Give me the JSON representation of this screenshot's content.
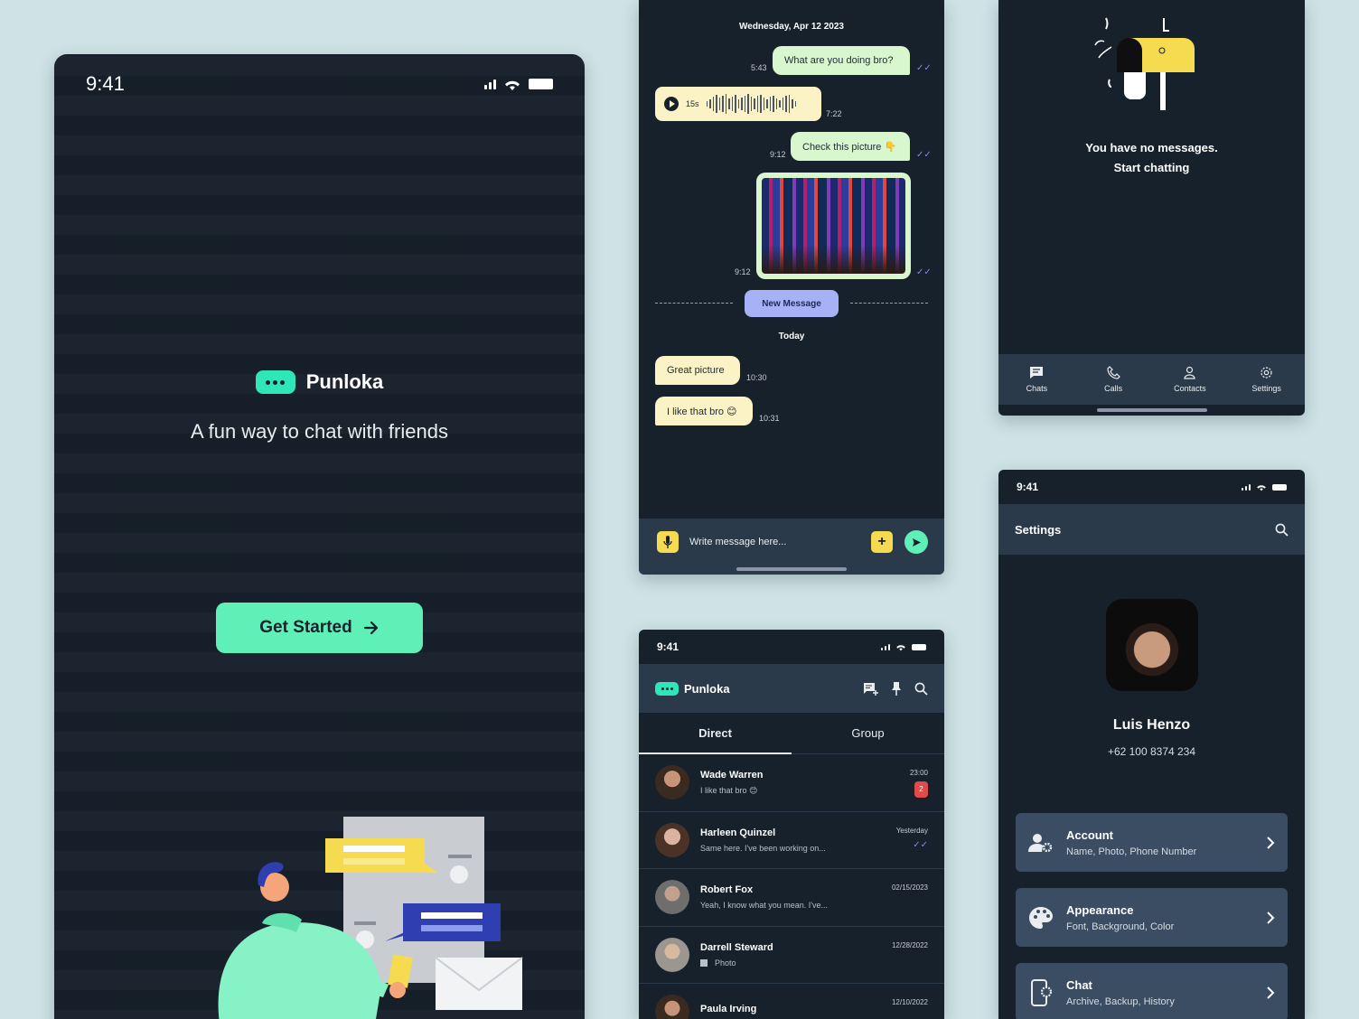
{
  "colors": {
    "background": "#cfe3e6",
    "screen": "#17212b",
    "surface": "#2b3a4a",
    "accent": "#5ff0b8",
    "yellow": "#f6da4f",
    "outgoing": "#d8f7cf",
    "incoming": "#fbf2c5",
    "badge": "#e04a4a"
  },
  "splash": {
    "time": "9:41",
    "brand": "Punloka",
    "tagline": "A fun way to chat with friends",
    "cta": "Get Started"
  },
  "conversation": {
    "date": "Wednesday, Apr 12 2023",
    "messages": [
      {
        "text": "What are you doing bro?",
        "time": "5:43"
      },
      {
        "voice_duration": "15s",
        "time": "7:22"
      },
      {
        "text": "Check this picture 👇",
        "time": "9:12"
      },
      {
        "photo": "photo-message",
        "time": "9:12"
      }
    ],
    "new_message_label": "New Message",
    "today_label": "Today",
    "today_messages": [
      {
        "text": "Great picture",
        "time": "10:30"
      },
      {
        "text": "I like that bro 😊",
        "time": "10:31"
      }
    ],
    "composer_placeholder": "Write message here...",
    "plus_label": "+"
  },
  "empty_state": {
    "line1": "You have no messages.",
    "line2": "Start chatting",
    "tabs": [
      {
        "label": "Chats",
        "icon": "chat-icon"
      },
      {
        "label": "Calls",
        "icon": "phone-icon"
      },
      {
        "label": "Contacts",
        "icon": "contacts-icon"
      },
      {
        "label": "Settings",
        "icon": "gear-icon"
      }
    ]
  },
  "chat_list": {
    "time": "9:41",
    "title": "Punloka",
    "tabs": [
      "Direct",
      "Group"
    ],
    "chats": [
      {
        "name": "Wade Warren",
        "preview": "I like that bro 😊",
        "time": "23:00",
        "badge": "2",
        "avatar": "#6b4a36"
      },
      {
        "name": "Harleen Quinzel",
        "preview": "Same here. I've been working on...",
        "time": "Yesterday",
        "avatar": "#8a6a58"
      },
      {
        "name": "Robert Fox",
        "preview": "Yeah, I know what you mean. I've...",
        "time": "02/15/2023",
        "avatar": "#9a9a9a"
      },
      {
        "name": "Darrell Steward",
        "preview": "Photo",
        "time": "12/28/2022",
        "avatar": "#b0aaa4"
      },
      {
        "name": "Paula Irving",
        "preview": "",
        "time": "12/10/2022",
        "avatar": "#5a4438"
      }
    ]
  },
  "settings": {
    "time": "9:41",
    "title": "Settings",
    "profile_name": "Luis Henzo",
    "profile_phone": "+62 100 8374 234",
    "items": [
      {
        "title": "Account",
        "subtitle": "Name, Photo, Phone Number",
        "icon": "account-gear-icon"
      },
      {
        "title": "Appearance",
        "subtitle": "Font, Background, Color",
        "icon": "palette-icon"
      },
      {
        "title": "Chat",
        "subtitle": "Archive, Backup, History",
        "icon": "chat-settings-icon"
      }
    ]
  }
}
